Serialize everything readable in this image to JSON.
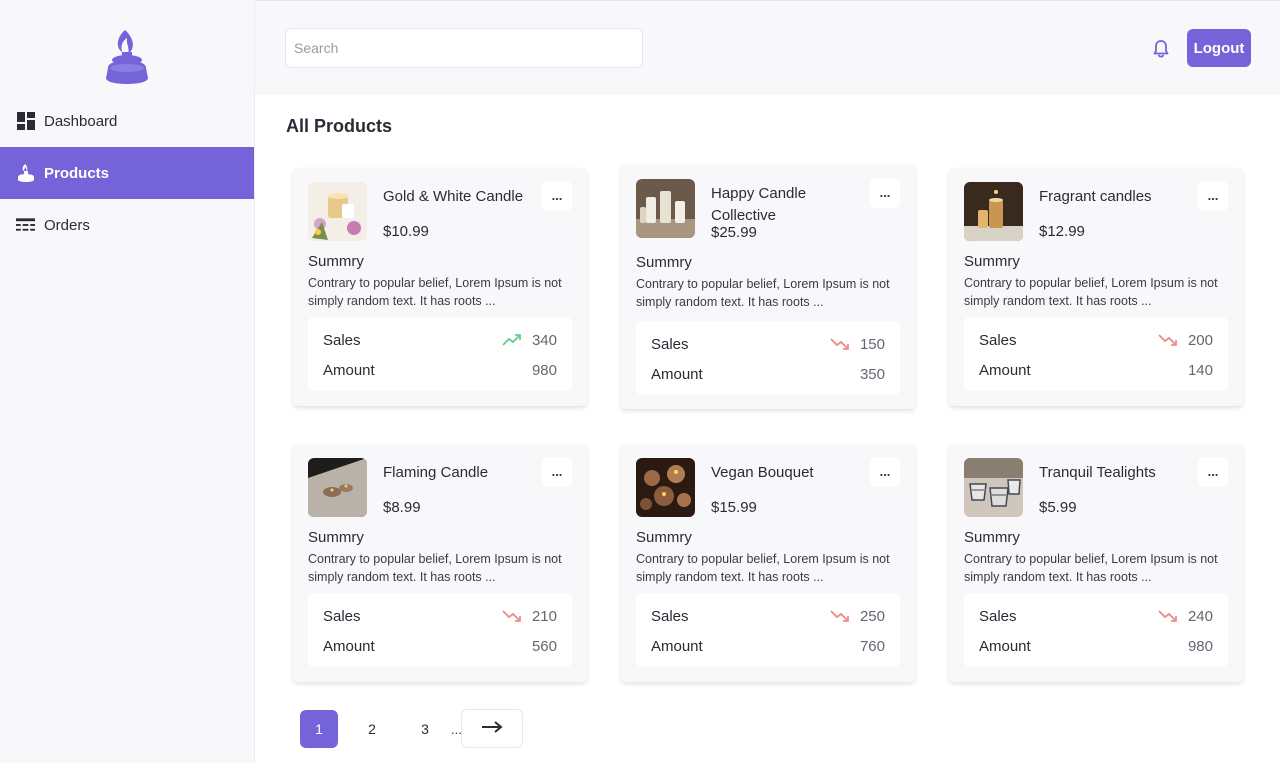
{
  "search": {
    "placeholder": "Search"
  },
  "header": {
    "logout_label": "Logout"
  },
  "sidebar": {
    "items": [
      {
        "label": "Dashboard",
        "icon": "dashboard-icon",
        "active": false
      },
      {
        "label": "Products",
        "icon": "candle-icon",
        "active": true
      },
      {
        "label": "Orders",
        "icon": "orders-icon",
        "active": false
      }
    ]
  },
  "page": {
    "title": "All Products"
  },
  "colors": {
    "accent": "#7564d9",
    "trend_up": "#5fcf8f",
    "trend_down": "#f08a8a"
  },
  "products": [
    {
      "name": "Gold & White Candle",
      "price": "$10.99",
      "more": "...",
      "summary_label": "Summry",
      "summary": "Contrary to popular belief, Lorem Ipsum is not simply random text. It has roots ...",
      "sales_label": "Sales",
      "sales": "340",
      "trend": "up",
      "amount_label": "Amount",
      "amount": "980"
    },
    {
      "name": "Happy Candle Collective",
      "price": "$25.99",
      "more": "...",
      "summary_label": "Summry",
      "summary": "Contrary to popular belief, Lorem Ipsum is not simply random text. It has roots ...",
      "sales_label": "Sales",
      "sales": "150",
      "trend": "down",
      "amount_label": "Amount",
      "amount": "350"
    },
    {
      "name": "Fragrant candles",
      "price": "$12.99",
      "more": "...",
      "summary_label": "Summry",
      "summary": "Contrary to popular belief, Lorem Ipsum is not simply random text. It has roots ...",
      "sales_label": "Sales",
      "sales": "200",
      "trend": "down",
      "amount_label": "Amount",
      "amount": "140"
    },
    {
      "name": "Flaming Candle",
      "price": "$8.99",
      "more": "...",
      "summary_label": "Summry",
      "summary": "Contrary to popular belief, Lorem Ipsum is not simply random text. It has roots ...",
      "sales_label": "Sales",
      "sales": "210",
      "trend": "down",
      "amount_label": "Amount",
      "amount": "560"
    },
    {
      "name": "Vegan Bouquet",
      "price": "$15.99",
      "more": "...",
      "summary_label": "Summry",
      "summary": "Contrary to popular belief, Lorem Ipsum is not simply random text. It has roots ...",
      "sales_label": "Sales",
      "sales": "250",
      "trend": "down",
      "amount_label": "Amount",
      "amount": "760"
    },
    {
      "name": "Tranquil Tealights",
      "price": "$5.99",
      "more": "...",
      "summary_label": "Summry",
      "summary": "Contrary to popular belief, Lorem Ipsum is not simply random text. It has roots ...",
      "sales_label": "Sales",
      "sales": "240",
      "trend": "down",
      "amount_label": "Amount",
      "amount": "980"
    }
  ],
  "pagination": {
    "pages": [
      "1",
      "2",
      "3"
    ],
    "current": "1",
    "ellipsis": "...",
    "next_icon": "arrow-right-icon"
  }
}
